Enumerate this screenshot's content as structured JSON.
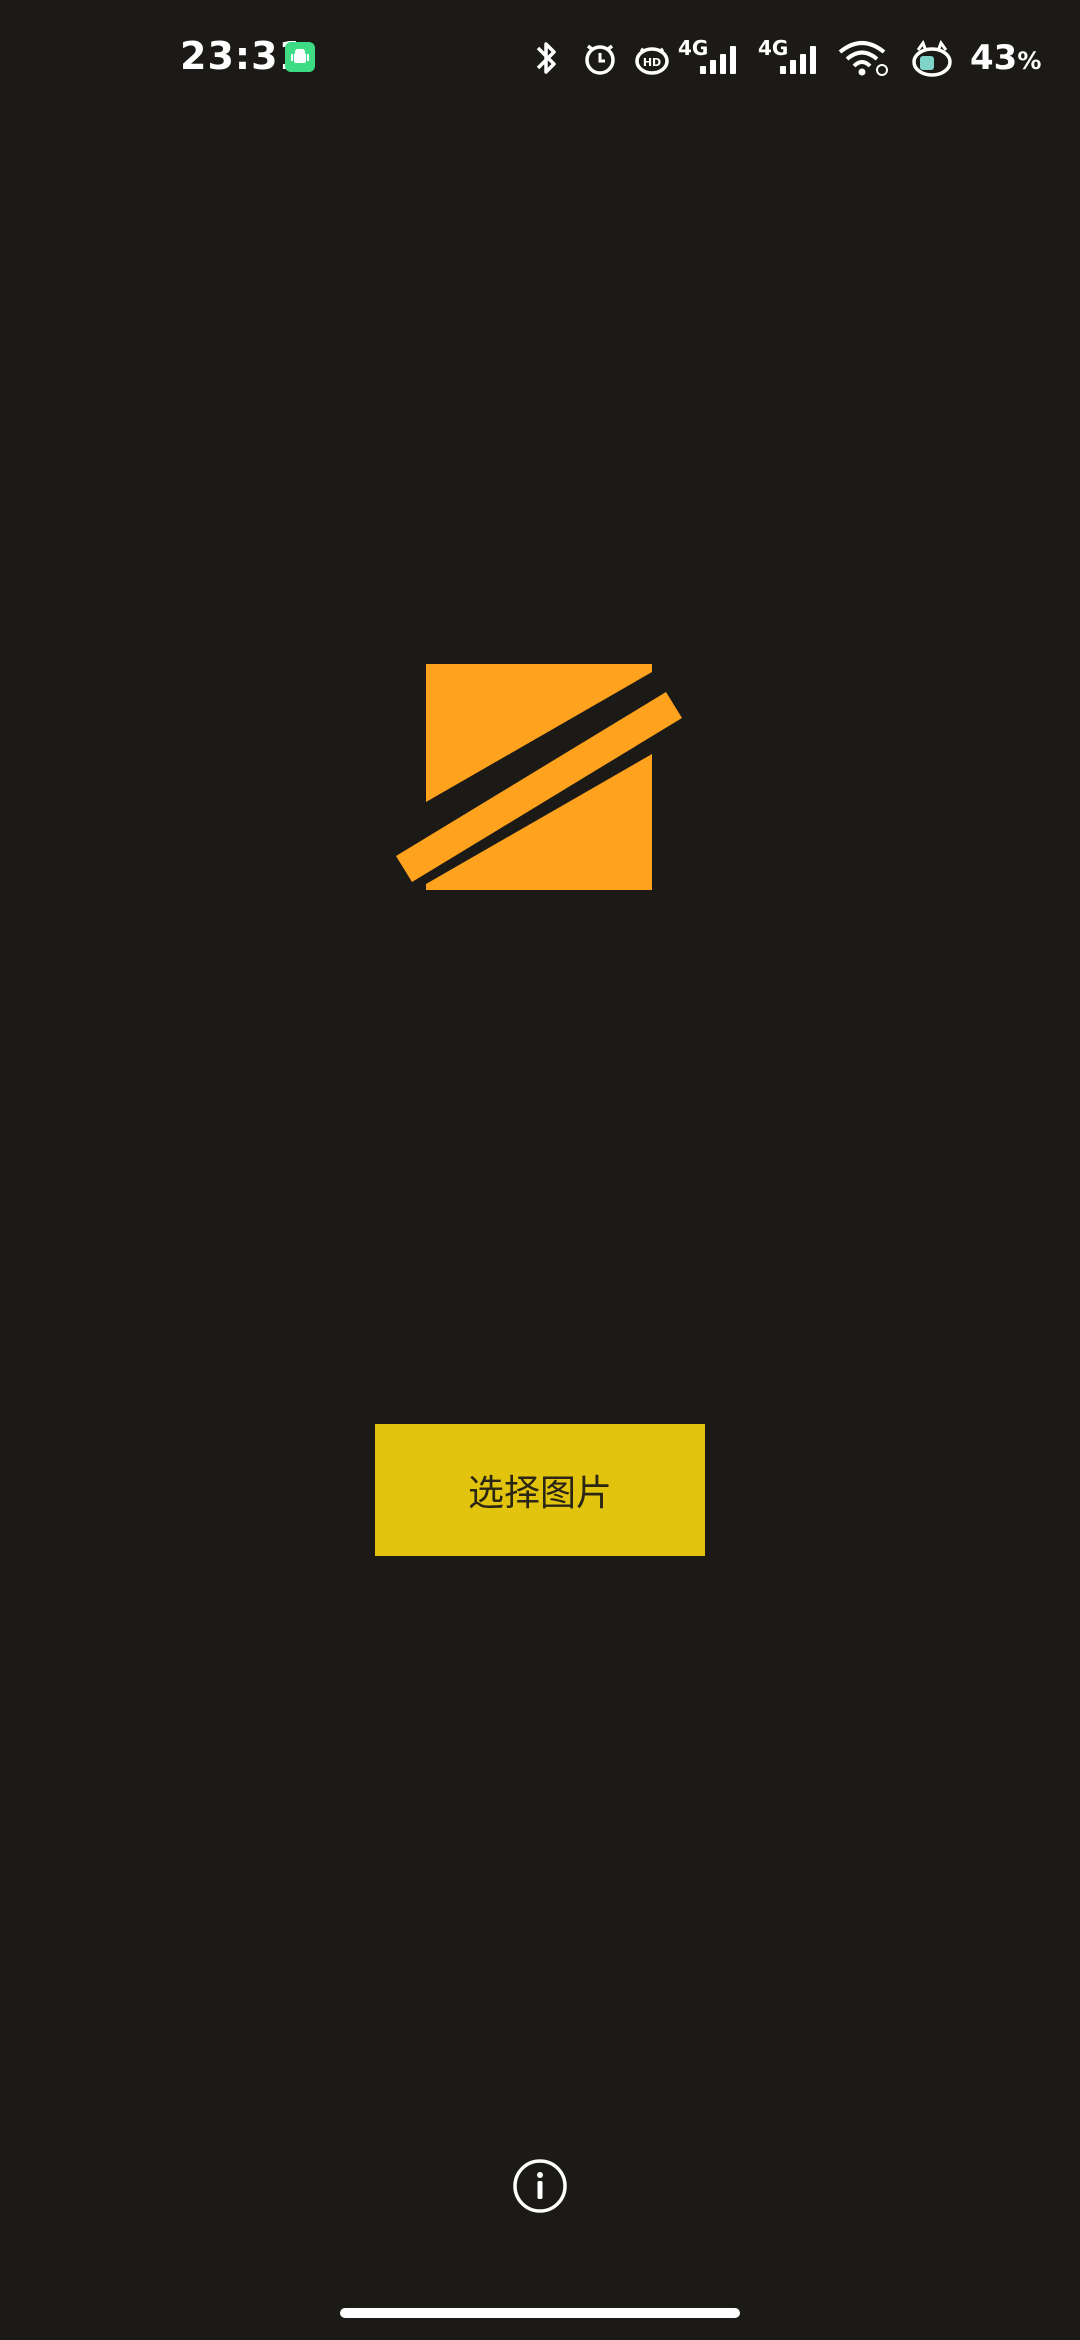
{
  "status_bar": {
    "time": "23:31",
    "net_label_1": "4G",
    "net_label_2": "4G",
    "battery_value": "43",
    "battery_unit": "%",
    "icons": [
      "android-notification-icon",
      "bluetooth-icon",
      "alarm-icon",
      "hd-voice-icon",
      "signal-icon",
      "signal-icon",
      "wifi-icon",
      "battery-icon"
    ]
  },
  "main": {
    "logo_icon": "app-logo-icon",
    "select_button_label": "选择图片"
  },
  "footer": {
    "info_icon": "info-icon"
  },
  "colors": {
    "background": "#1c1a16",
    "logo_orange": "#ffa31f",
    "button_yellow": "#e2c40e",
    "button_text": "#2b2614"
  }
}
